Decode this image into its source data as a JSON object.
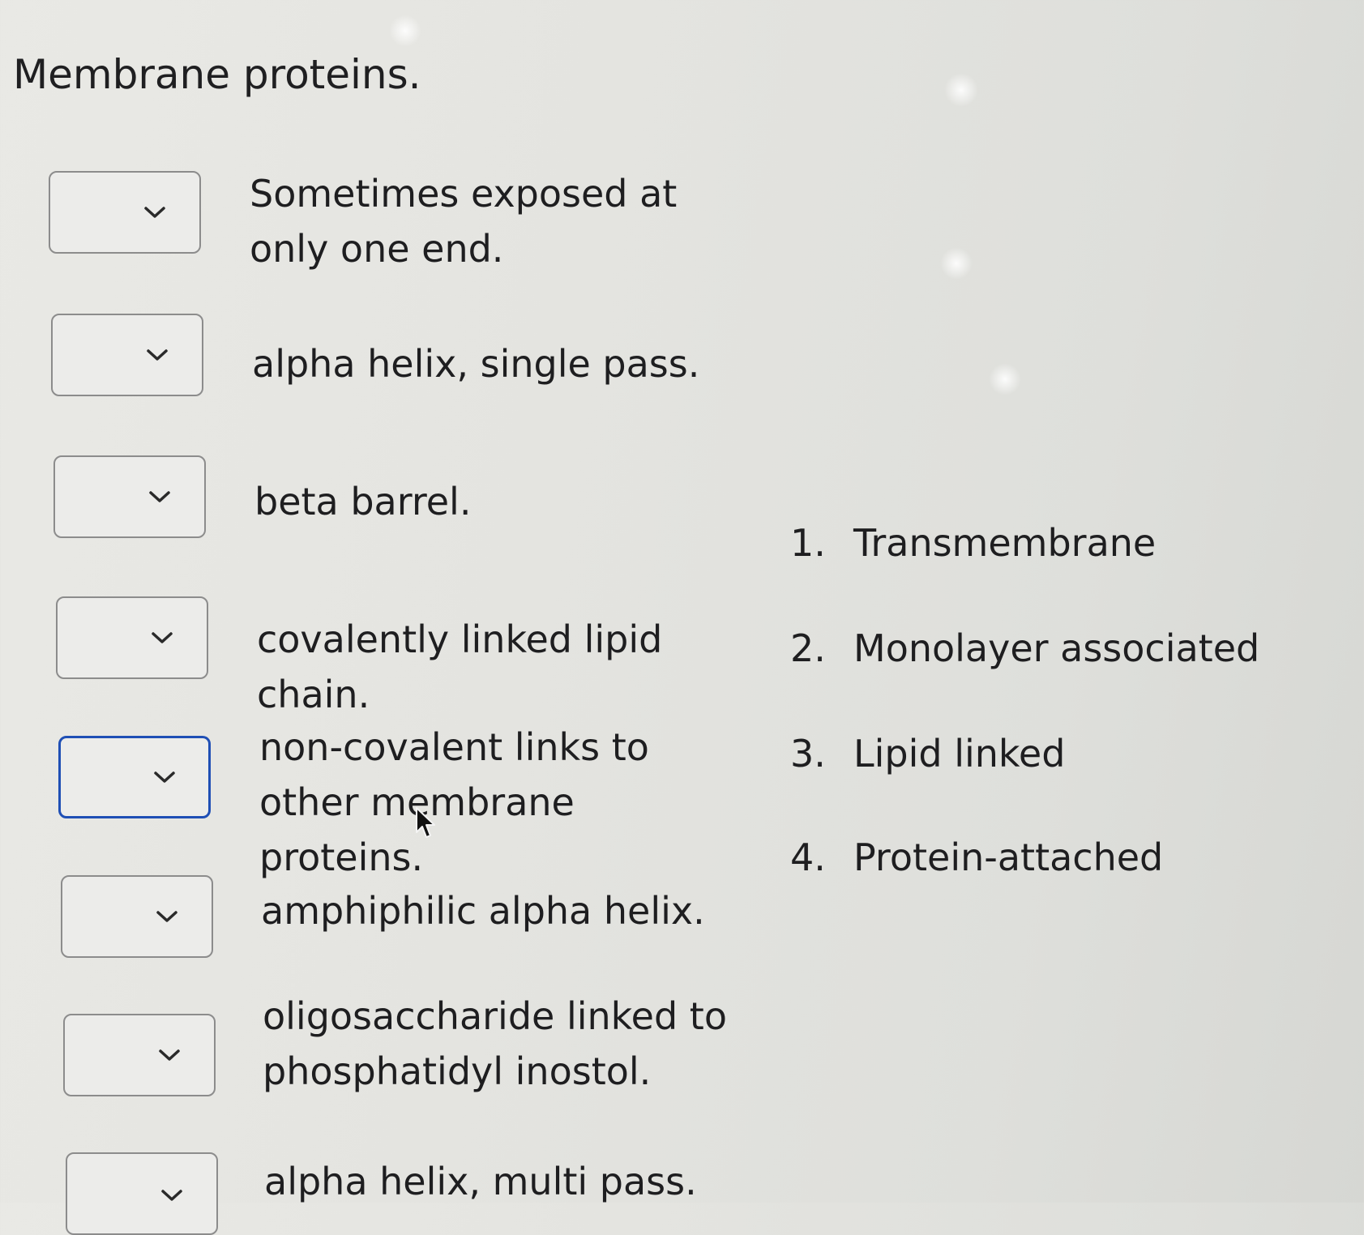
{
  "title": "Membrane proteins.",
  "items": [
    {
      "text": "Sometimes exposed at only one end.",
      "selected": ""
    },
    {
      "text": "alpha helix, single pass.",
      "selected": ""
    },
    {
      "text": "beta barrel.",
      "selected": ""
    },
    {
      "text": "covalently linked lipid chain.",
      "selected": ""
    },
    {
      "text": "non-covalent links to other membrane proteins.",
      "selected": ""
    },
    {
      "text": "amphiphilic alpha helix.",
      "selected": ""
    },
    {
      "text": "oligosaccharide linked to phosphatidyl inostol.",
      "selected": ""
    },
    {
      "text": "alpha helix, multi pass.",
      "selected": ""
    }
  ],
  "options": [
    {
      "num": "1.",
      "label": "Transmembrane"
    },
    {
      "num": "2.",
      "label": "Monolayer associated"
    },
    {
      "num": "3.",
      "label": "Lipid linked"
    },
    {
      "num": "4.",
      "label": "Protein-attached"
    }
  ],
  "colors": {
    "focus_border": "#1f4fb5",
    "dropdown_border": "#8c8c8c",
    "background": "#e4e4e0"
  },
  "icons": {
    "dropdown": "chevron-down-icon",
    "cursor": "mouse-pointer-icon"
  }
}
